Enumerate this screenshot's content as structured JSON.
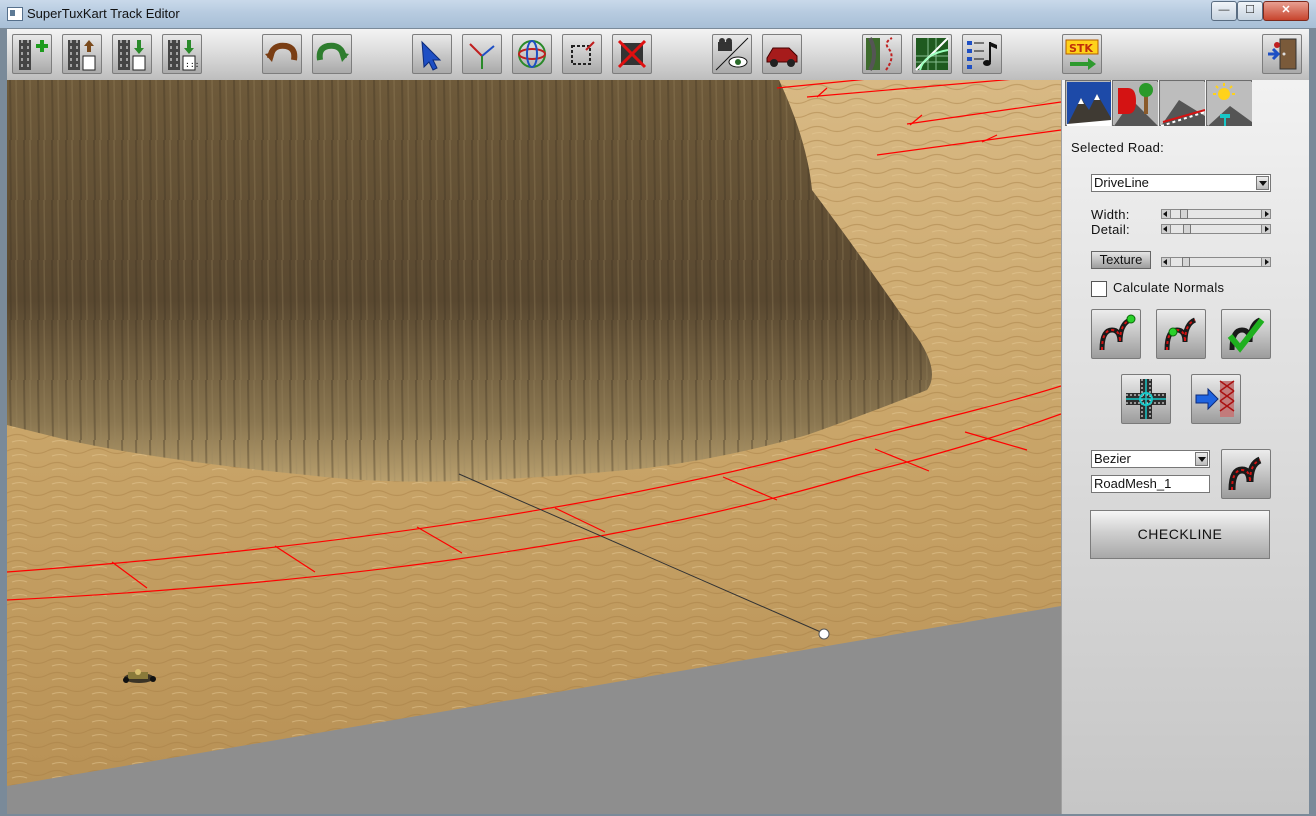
{
  "window": {
    "title": "SuperTuxKart Track Editor",
    "min_glyph": "—",
    "max_glyph": "☐",
    "close_glyph": "✕"
  },
  "toolbar": {
    "buttons": [
      "new-track",
      "open-track",
      "save-track",
      "save-track-as",
      "undo",
      "redo",
      "select",
      "move",
      "rotate",
      "scale",
      "delete",
      "camera",
      "test-drive",
      "road-editor",
      "terrain-editor",
      "music",
      "stk-export",
      "exit"
    ]
  },
  "panel": {
    "tabs": [
      "terrain",
      "scenery",
      "road",
      "environment"
    ],
    "selected_road_label": "Selected Road:",
    "road_select": {
      "value": "DriveLine"
    },
    "width_label": "Width:",
    "detail_label": "Detail:",
    "texture_button": "Texture",
    "width_level": 0.12,
    "detail_level": 0.15,
    "texture_level": 0.14,
    "calculate_normals_label": "Calculate Normals",
    "calculate_normals_checked": false,
    "spline_select": {
      "value": "Bezier"
    },
    "mesh_name_value": "RoadMesh_1",
    "checkline_label": "CHECKLINE"
  },
  "colors": {
    "road_line": "#ff0000",
    "sand": "#c9a56a",
    "ground_void": "#8e8e8e"
  }
}
